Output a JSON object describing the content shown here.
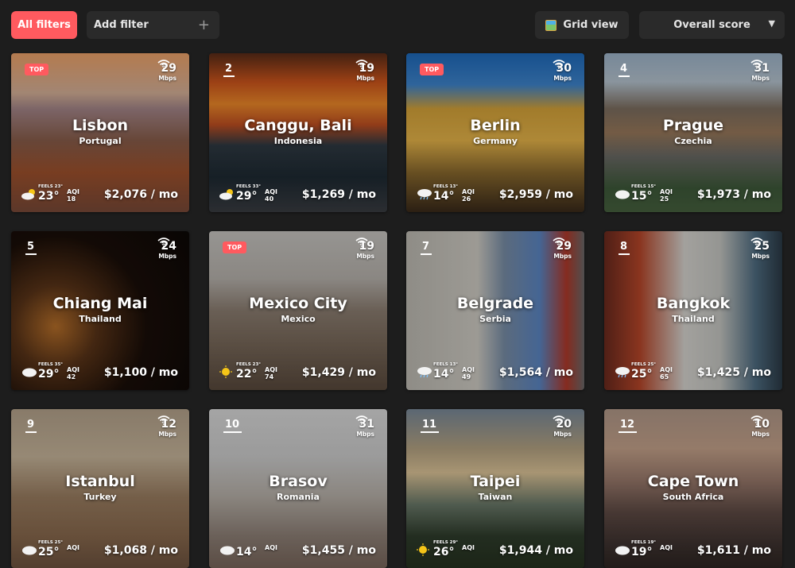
{
  "toolbar": {
    "all_filters_label": "All filters",
    "add_filter_label": "Add filter",
    "grid_view_label": "Grid view",
    "sort_selected": "Overall score"
  },
  "cards": [
    {
      "badge": "TOP",
      "rank": "",
      "speed": "29",
      "unit": "Mbps",
      "city": "Lisbon",
      "country": "Portugal",
      "feels": "FEELS 23°",
      "temp": "23°",
      "aqi": "AQI",
      "aqi_value": "18",
      "price": "$2,076 / mo",
      "weather": "cloud-sun",
      "bg": "linear-gradient(180deg,#f0a46a 0%,#d9b39a 25%,#a6878a 35%,#8a5e4b 55%,#a0522d 75%,#7a4a38 100%)"
    },
    {
      "badge": "",
      "rank": "2",
      "speed": "19",
      "unit": "Mbps",
      "city": "Canggu, Bali",
      "country": "Indonesia",
      "feels": "FEELS 33°",
      "temp": "29°",
      "aqi": "AQI",
      "aqi_value": "40",
      "price": "$1,269 / mo",
      "weather": "cloud-sun",
      "bg": "linear-gradient(180deg,#5a2c18 0%,#d0561c 18%,#f08a2a 32%,#c25022 45%,#2f3a43 58%,#1e2a33 78%,#3a3d42 100%)"
    },
    {
      "badge": "TOP",
      "rank": "",
      "speed": "30",
      "unit": "Mbps",
      "city": "Berlin",
      "country": "Germany",
      "feels": "FEELS 13°",
      "temp": "14°",
      "aqi": "AQI",
      "aqi_value": "26",
      "price": "$2,959 / mo",
      "weather": "cloud-rain",
      "bg": "linear-gradient(180deg,#1e6bbd 0%,#3f86cf 20%,#d8a53a 35%,#e8b64a 55%,#8b6a2e 75%,#3a2a1a 100%)"
    },
    {
      "badge": "",
      "rank": "4",
      "speed": "31",
      "unit": "Mbps",
      "city": "Prague",
      "country": "Czechia",
      "feels": "FEELS 15°",
      "temp": "15°",
      "aqi": "AQI",
      "aqi_value": "25",
      "price": "$1,973 / mo",
      "weather": "cloud",
      "bg": "linear-gradient(180deg,#9fb6cc 0%,#b8c6d2 18%,#7e6f60 35%,#9a7a5c 50%,#6b6b66 65%,#3e5a3a 85%,#47623f 100%)"
    },
    {
      "badge": "",
      "rank": "5",
      "speed": "24",
      "unit": "Mbps",
      "city": "Chiang Mai",
      "country": "Thailand",
      "feels": "FEELS 35°",
      "temp": "29°",
      "aqi": "AQI",
      "aqi_value": "42",
      "price": "$1,100 / mo",
      "weather": "cloud",
      "bg": "radial-gradient(circle at 25% 60%,#b8702a 0%,#5a3418 25%,#1a0e08 55%,#0c0806 100%)"
    },
    {
      "badge": "TOP",
      "rank": "",
      "speed": "19",
      "unit": "Mbps",
      "city": "Mexico City",
      "country": "Mexico",
      "feels": "FEELS 23°",
      "temp": "22°",
      "aqi": "AQI",
      "aqi_value": "74",
      "price": "$1,429 / mo",
      "weather": "sun",
      "bg": "linear-gradient(180deg,#c9c7c3 0%,#b9b4ae 30%,#8d7f72 50%,#7a6a5b 70%,#5a4a3d 100%)"
    },
    {
      "badge": "",
      "rank": "7",
      "speed": "29",
      "unit": "Mbps",
      "city": "Belgrade",
      "country": "Serbia",
      "feels": "FEELS 13°",
      "temp": "14°",
      "aqi": "AQI",
      "aqi_value": "49",
      "price": "$1,564 / mo",
      "weather": "cloud-rain",
      "bg": "linear-gradient(90deg,#bfbcb4 0%,#d1cec6 40%,#7a8fa8 55%,#5c87c5 75%,#b23a2a 90%,#6a6a6a 100%)"
    },
    {
      "badge": "",
      "rank": "8",
      "speed": "25",
      "unit": "Mbps",
      "city": "Bangkok",
      "country": "Thailand",
      "feels": "FEELS 25°",
      "temp": "25°",
      "aqi": "AQI",
      "aqi_value": "65",
      "price": "$1,425 / mo",
      "weather": "cloud-rain",
      "bg": "linear-gradient(90deg,#6b2a1e 0%,#b8472a 20%,#d9d7d2 45%,#c7c8c4 65%,#4f6d82 85%,#2b3a46 100%)"
    },
    {
      "badge": "",
      "rank": "9",
      "speed": "12",
      "unit": "Mbps",
      "city": "Istanbul",
      "country": "Turkey",
      "feels": "FEELS 25°",
      "temp": "25°",
      "aqi": "AQI",
      "aqi_value": "",
      "price": "$1,068 / mo",
      "weather": "cloud",
      "bg": "linear-gradient(180deg,#b6a48d 0%,#c9b79c 30%,#9c7f62 55%,#8a6a4e 80%,#6f5440 100%)"
    },
    {
      "badge": "",
      "rank": "10",
      "speed": "31",
      "unit": "Mbps",
      "city": "Brasov",
      "country": "Romania",
      "feels": "",
      "temp": "14°",
      "aqi": "AQI",
      "aqi_value": "",
      "price": "$1,455 / mo",
      "weather": "cloud",
      "bg": "linear-gradient(180deg,#dcdcdc 0%,#cfcfcf 30%,#b9b2aa 55%,#8f8177 80%,#7a675c 100%)"
    },
    {
      "badge": "",
      "rank": "11",
      "speed": "20",
      "unit": "Mbps",
      "city": "Taipei",
      "country": "Taiwan",
      "feels": "FEELS 29°",
      "temp": "26°",
      "aqi": "AQI",
      "aqi_value": "",
      "price": "$1,944 / mo",
      "weather": "sun",
      "bg": "linear-gradient(180deg,#7a8a9a 0%,#b7a584 25%,#e0c79a 40%,#6b7a6a 60%,#2f3d2c 80%,#26321f 100%)"
    },
    {
      "badge": "",
      "rank": "12",
      "speed": "10",
      "unit": "Mbps",
      "city": "Cape Town",
      "country": "South Africa",
      "feels": "FEELS 19°",
      "temp": "19°",
      "aqi": "AQI",
      "aqi_value": "",
      "price": "$1,611 / mo",
      "weather": "cloud",
      "bg": "linear-gradient(180deg,#b39a8a 0%,#c7a48c 25%,#9a7a6c 45%,#5f4b45 65%,#3f3330 85%,#2d2522 100%)"
    }
  ]
}
